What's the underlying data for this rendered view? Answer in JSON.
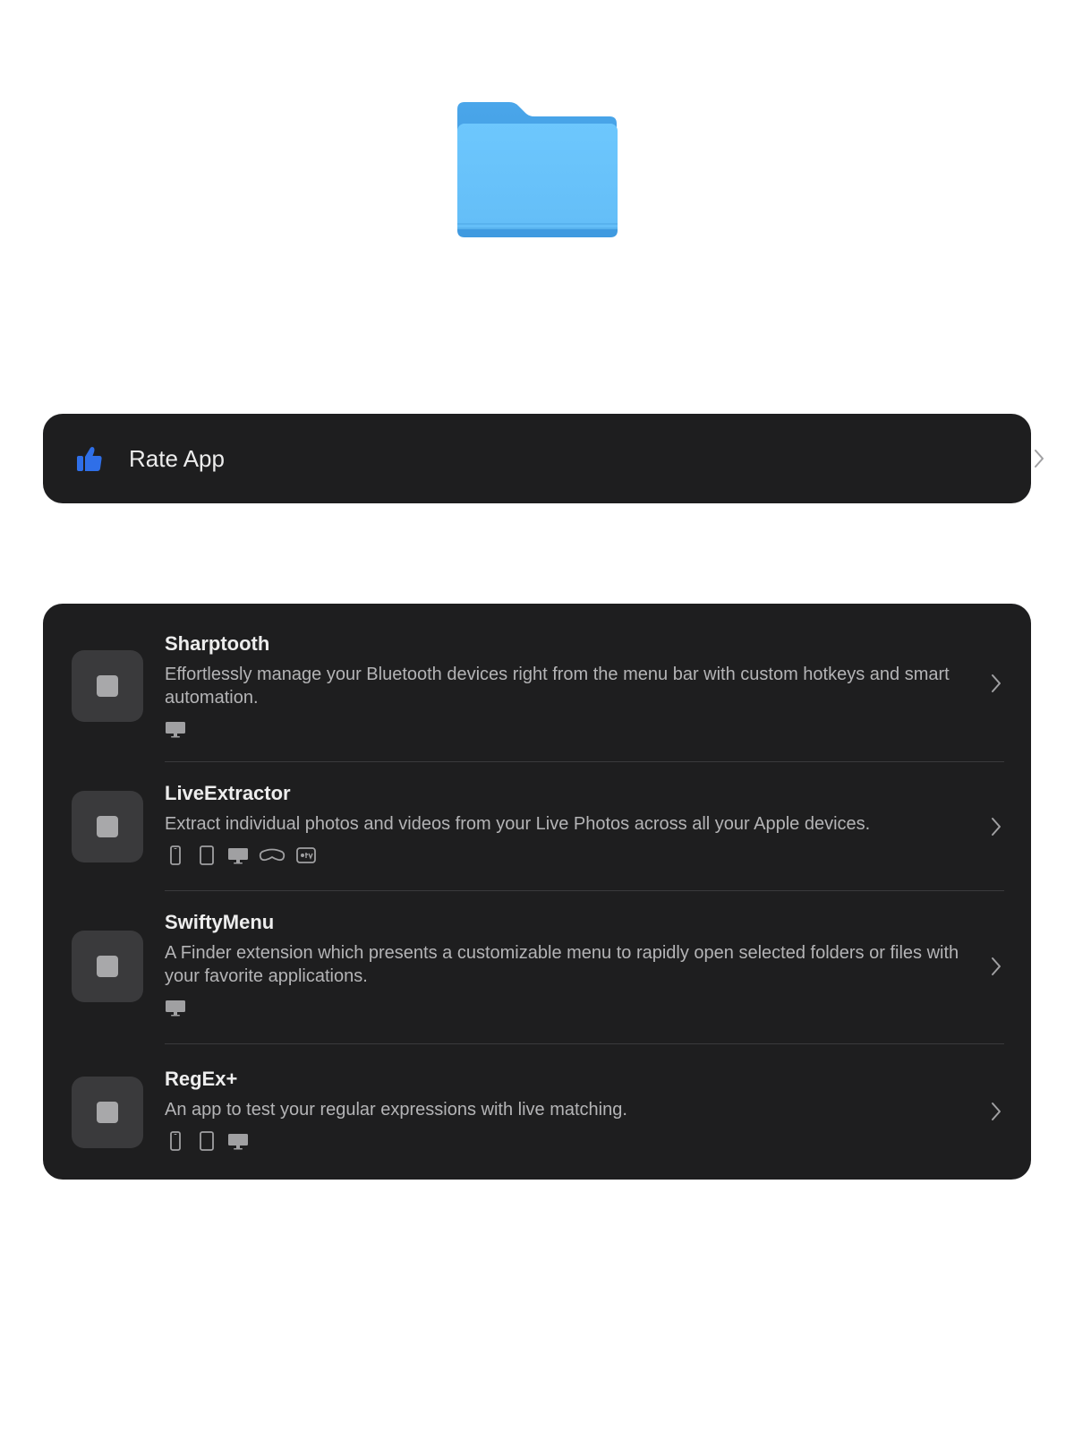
{
  "rate": {
    "label": "Rate App",
    "icon": "thumbs-up-icon",
    "accent": "#2f6fe8"
  },
  "apps": [
    {
      "name": "Sharptooth",
      "description": "Effortlessly manage your Bluetooth devices right from the menu bar with custom hotkeys and smart automation.",
      "platforms": [
        "mac"
      ]
    },
    {
      "name": "LiveExtractor",
      "description": "Extract individual photos and videos from your Live Photos across all your Apple devices.",
      "platforms": [
        "iphone",
        "ipad",
        "mac",
        "vision",
        "tv"
      ]
    },
    {
      "name": "SwiftyMenu",
      "description": "A Finder extension which presents a customizable menu to rapidly open selected folders or files with your favorite applications.",
      "platforms": [
        "mac"
      ]
    },
    {
      "name": "RegEx+",
      "description": "An app to test your regular expressions with live matching.",
      "platforms": [
        "iphone",
        "ipad",
        "mac"
      ]
    }
  ],
  "colors": {
    "card_background": "#1e1e1f",
    "folder_blue": "#6ac4fb",
    "text_primary": "#ececec",
    "text_secondary": "#b4b4b6"
  }
}
